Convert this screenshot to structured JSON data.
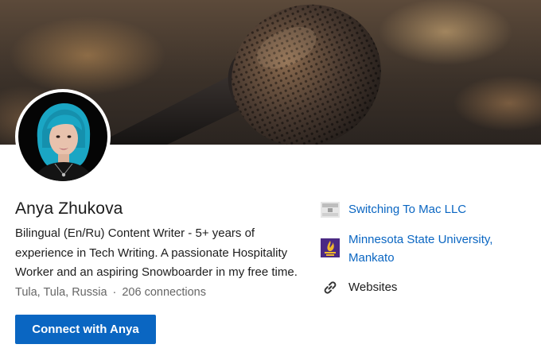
{
  "profile": {
    "name": "Anya Zhukova",
    "headline": "Bilingual (En/Ru) Content Writer - 5+ years of experience in Tech Writing. A passionate Hospitality Worker and an aspiring Snowboarder in my free time.",
    "location": "Tula, Tula, Russia",
    "separator": "·",
    "connections": "206 connections",
    "connect_label": "Connect with Anya"
  },
  "sidebar": {
    "company": {
      "label": "Switching To Mac LLC",
      "icon": "company-logo-icon",
      "logo_text": "SWITCHING TO MAC"
    },
    "school": {
      "label": "Minnesota State University, Mankato",
      "icon": "university-logo-icon"
    },
    "websites": {
      "label": "Websites",
      "icon": "link-icon"
    }
  },
  "colors": {
    "accent": "#0a66c2",
    "text": "#1d1d1d",
    "muted": "#666666",
    "school_purple": "#4b2a84",
    "school_gold": "#f2b92a"
  }
}
